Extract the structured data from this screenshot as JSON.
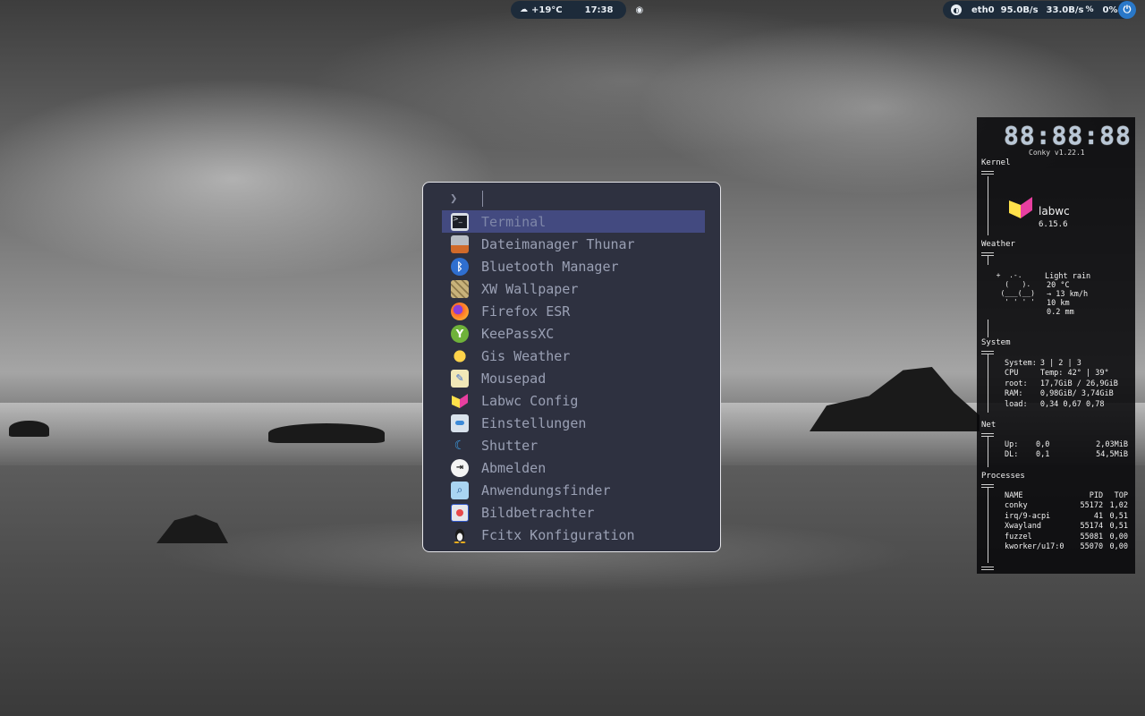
{
  "topbar": {
    "weather": "+19°C",
    "time": "17:38",
    "net_iface": "eth0",
    "net_down": "95.0B/s",
    "net_up": "33.0B/s",
    "volume": "0%"
  },
  "launcher": {
    "prompt": "❯",
    "query": "",
    "items": [
      {
        "label": "Terminal",
        "icon": "terminal-icon"
      },
      {
        "label": "Dateimanager Thunar",
        "icon": "file-manager-icon"
      },
      {
        "label": "Bluetooth Manager",
        "icon": "bluetooth-icon"
      },
      {
        "label": "XW Wallpaper",
        "icon": "wallpaper-icon"
      },
      {
        "label": "Firefox ESR",
        "icon": "firefox-icon"
      },
      {
        "label": "KeePassXC",
        "icon": "keepassxc-icon"
      },
      {
        "label": "Gis Weather",
        "icon": "weather-sun-icon"
      },
      {
        "label": "Mousepad",
        "icon": "text-editor-icon"
      },
      {
        "label": "Labwc Config",
        "icon": "labwc-icon"
      },
      {
        "label": "Einstellungen",
        "icon": "settings-icon"
      },
      {
        "label": "Shutter",
        "icon": "screenshot-icon"
      },
      {
        "label": "Abmelden",
        "icon": "logout-icon"
      },
      {
        "label": "Anwendungsfinder",
        "icon": "app-finder-icon"
      },
      {
        "label": "Bildbetrachter",
        "icon": "image-viewer-icon"
      },
      {
        "label": "Fcitx Konfiguration",
        "icon": "tux-icon"
      }
    ],
    "selected_index": 0
  },
  "conky": {
    "clock": "88:88:88",
    "version": "Conky v1.22.1",
    "kernel_title": "Kernel",
    "wm_name": "labwc",
    "kernel_version": "6.15.6",
    "weather_title": "Weather",
    "weather_art": "  +  .-.\n    (   ).\n   (___(__)\n    ' ' ' '",
    "weather_desc": "Light rain",
    "weather_temp": "20 °C",
    "weather_wind": "→ 13 km/h",
    "weather_vis": "10 km",
    "weather_precip": "0.2 mm",
    "system_title": "System",
    "system_rows": [
      [
        "System:",
        "3 | 2 | 3"
      ],
      [
        "CPU",
        "Temp: 42° | 39°"
      ],
      [
        "root:",
        "17,7GiB / 26,9GiB"
      ],
      [
        "RAM:",
        "0,98GiB/ 3,74GiB"
      ],
      [
        "load:",
        "0,34 0,67 0,78"
      ]
    ],
    "net_title": "Net",
    "net_rows": [
      [
        "Up:",
        "0,0",
        "2,03MiB"
      ],
      [
        "DL:",
        "0,1",
        "54,5MiB"
      ]
    ],
    "proc_title": "Processes",
    "proc_header": [
      "NAME",
      "PID",
      "TOP"
    ],
    "proc_rows": [
      [
        "conky",
        "55172",
        "1,02"
      ],
      [
        "irq/9-acpi",
        "41",
        "0,51"
      ],
      [
        "Xwayland",
        "55174",
        "0,51"
      ],
      [
        "fuzzel",
        "55081",
        "0,00"
      ],
      [
        "kworker/u17:0",
        "55070",
        "0,00"
      ]
    ]
  }
}
